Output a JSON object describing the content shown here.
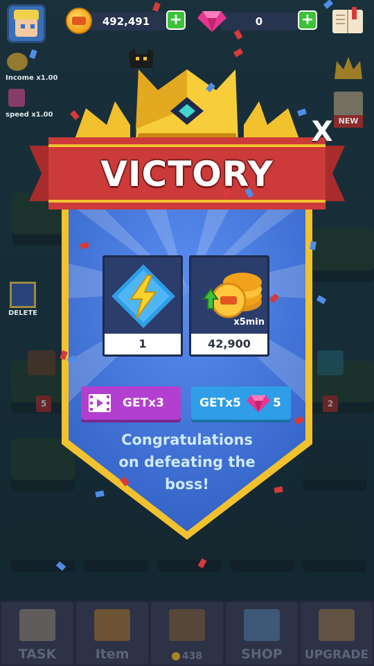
{
  "hud": {
    "coins": "492,491",
    "gems": "0",
    "income_label": "Income x1.00",
    "speed_label": "speed x1.00",
    "new_badge": "NEW",
    "delete_label": "DELETE",
    "level_left": "5",
    "level_right": "2"
  },
  "victory": {
    "title": "VICTORY",
    "close_label": "X",
    "rewards": [
      {
        "icon": "lightning-icon",
        "value": "1"
      },
      {
        "icon": "coin-stack-icon",
        "value": "42,900",
        "multiplier": "x5min"
      }
    ],
    "buttons": {
      "video_label": "GETx3",
      "gem_label": "GETx5",
      "gem_cost": "5"
    },
    "message_lines": [
      "Congratulations",
      "on defeating the",
      "boss!"
    ]
  },
  "nav": {
    "items": [
      {
        "label": "TASK"
      },
      {
        "label": "Item"
      },
      {
        "label": "438"
      },
      {
        "label": "SHOP"
      },
      {
        "label": "UPGRADE"
      }
    ]
  },
  "colors": {
    "ribbon_red": "#cc3a3a",
    "crown_gold": "#f2c12e",
    "panel_blue": "#3f74d6",
    "video_button": "#b23fcf",
    "gem_button": "#2f9de8",
    "gem_pink": "#e8368f"
  }
}
